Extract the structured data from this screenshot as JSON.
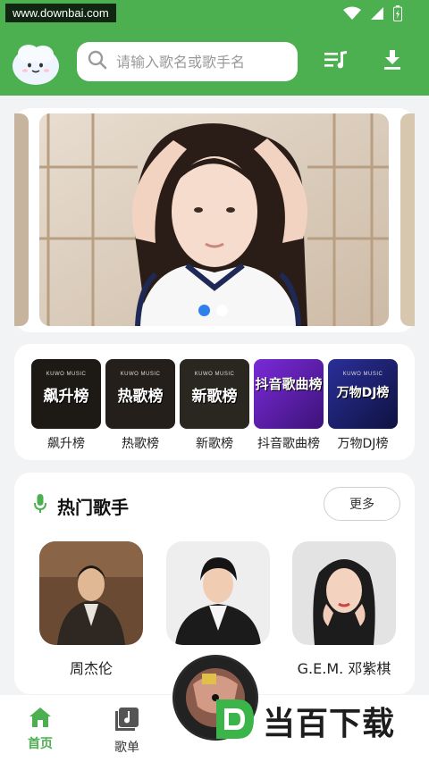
{
  "watermark_top": "www.downbai.com",
  "header": {
    "search_placeholder": "请输入歌名或歌手名"
  },
  "charts": [
    {
      "cover_title": "飙升榜",
      "label": "飙升榜",
      "bg": "#1d1a16"
    },
    {
      "cover_title": "热歌榜",
      "label": "热歌榜",
      "bg": "#241f1a"
    },
    {
      "cover_title": "新歌榜",
      "label": "新歌榜",
      "bg": "#2a2620"
    },
    {
      "cover_title": "抖音歌曲榜",
      "label": "抖音歌曲榜",
      "bg": "#5a1fa8"
    },
    {
      "cover_title": "万物DJ榜",
      "label": "万物DJ榜",
      "bg": "#1a1f6b"
    }
  ],
  "chart_cover_brand": "KUWO MUSIC",
  "hot_singers": {
    "title": "热门歌手",
    "more_label": "更多",
    "singers": [
      {
        "name": "周杰伦"
      },
      {
        "name": ""
      },
      {
        "name": "G.E.M. 邓紫棋"
      }
    ]
  },
  "bottom_nav": [
    {
      "label": "首页",
      "active": true
    },
    {
      "label": "歌单",
      "active": false
    }
  ],
  "brand_watermark": "当百下载",
  "colors": {
    "primary_green": "#4caf50",
    "dot_active": "#2f80ed"
  }
}
